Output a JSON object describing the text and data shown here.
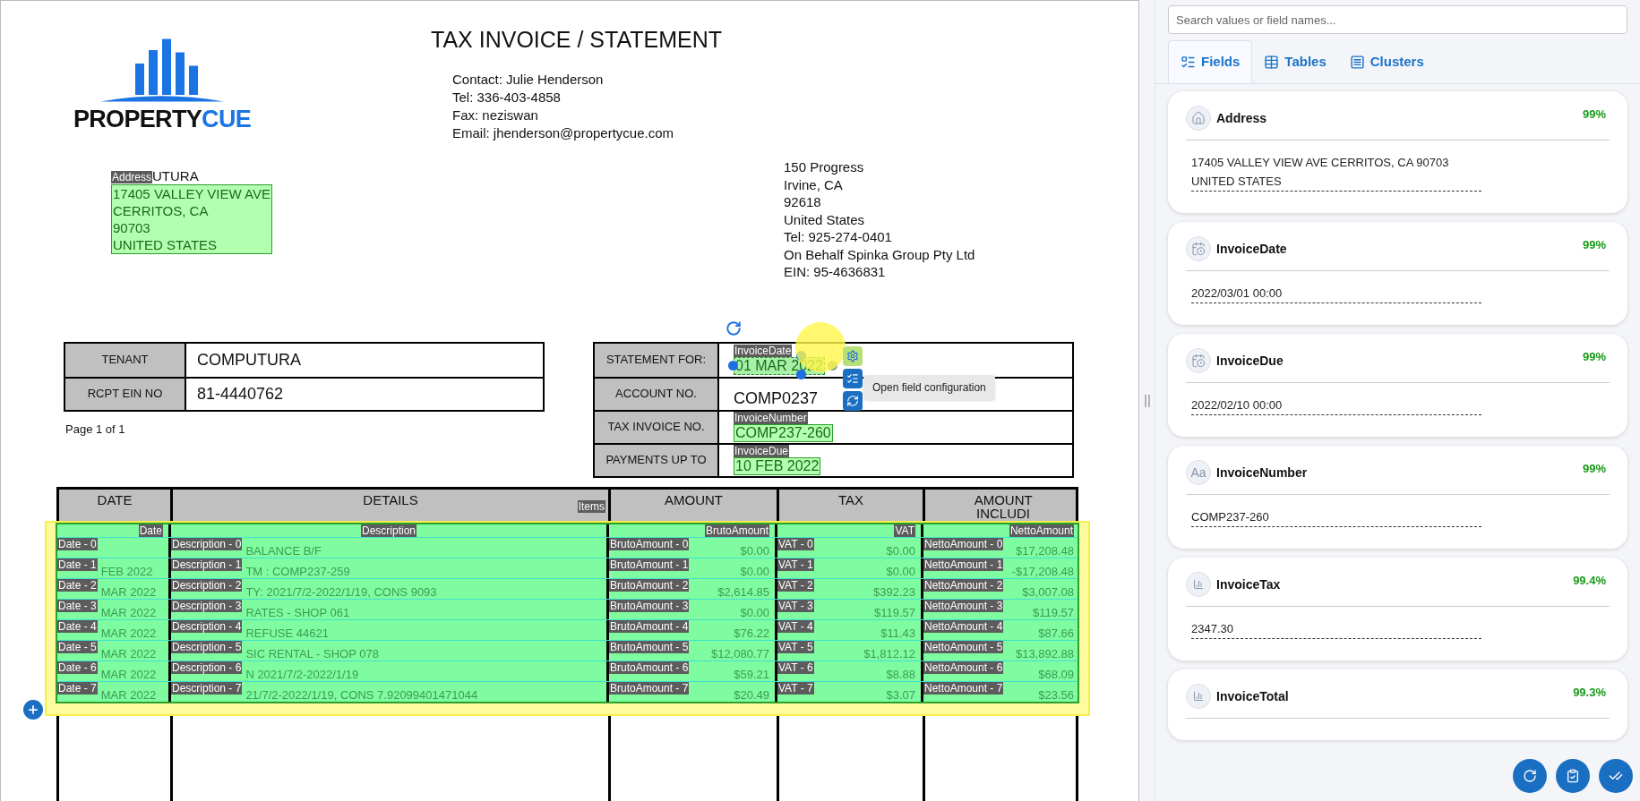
{
  "document": {
    "logo": {
      "word_dark": "PROPERTY",
      "word_accent": "CUE"
    },
    "title": "TAX INVOICE / STATEMENT",
    "contact_lines": [
      "Contact: Julie Henderson",
      "Tel: 336-403-4858",
      "Fax: neziswan",
      "Email: jhenderson@propertycue.com"
    ],
    "address_field": {
      "label": "Address",
      "above_text": "UTURA",
      "lines": [
        "17405 VALLEY VIEW AVE",
        "CERRITOS, CA",
        "90703",
        "UNITED STATES"
      ]
    },
    "sender_lines": [
      "150 Progress",
      "Irvine, CA",
      "92618",
      "United States",
      "Tel: 925-274-0401",
      "On Behalf Spinka Group Pty Ltd",
      "EIN: 95-4636831"
    ],
    "tenant_table": [
      {
        "label": "TENANT",
        "value": "COMPUTURA"
      },
      {
        "label": "RCPT EIN NO",
        "value": "81-4440762"
      }
    ],
    "page_note": "Page 1 of 1",
    "statement_table": [
      {
        "label": "STATEMENT FOR:",
        "field_label": "InvoiceDate",
        "value": "01 MAR 2022",
        "selected": true
      },
      {
        "label": "ACCOUNT NO.",
        "value": "COMP0237"
      },
      {
        "label": "TAX INVOICE NO.",
        "field_label": "InvoiceNumber",
        "value": "COMP237-260",
        "selected": false
      },
      {
        "label": "PAYMENTS UP TO",
        "field_label": "InvoiceDue",
        "value": "10 FEB 2022",
        "selected": false
      }
    ],
    "field_toolbar": {
      "tooltip": "Open field configuration"
    },
    "items_table": {
      "table_label": "Items",
      "columns": [
        {
          "heading": "DATE",
          "field_label": "Date",
          "kind": "text"
        },
        {
          "heading": "DETAILS",
          "field_label": "Description",
          "kind": "text"
        },
        {
          "heading": "AMOUNT",
          "field_label": "BrutoAmount",
          "kind": "amount"
        },
        {
          "heading": "TAX",
          "field_label": "VAT",
          "kind": "amount"
        },
        {
          "heading": "AMOUNT INCLUDI",
          "field_label": "NettoAmount",
          "kind": "amount"
        }
      ],
      "rows": [
        {
          "cells": [
            {
              "chip": "Date - 0"
            },
            {
              "chip": "Description - 0",
              "value": "BALANCE B/F"
            },
            {
              "chip": "BrutoAmount - 0",
              "value": "$0.00"
            },
            {
              "chip": "VAT - 0",
              "value": "$0.00"
            },
            {
              "chip": "NettoAmount - 0",
              "value": "$17,208.48"
            }
          ]
        },
        {
          "cells": [
            {
              "chip": "Date - 1",
              "value": "FEB 2022"
            },
            {
              "chip": "Description - 1",
              "value": "TM : COMP237-259"
            },
            {
              "chip": "BrutoAmount - 1",
              "value": "$0.00"
            },
            {
              "chip": "VAT - 1",
              "value": "$0.00"
            },
            {
              "chip": "NettoAmount - 1",
              "value": "-$17,208.48"
            }
          ]
        },
        {
          "cells": [
            {
              "chip": "Date - 2",
              "value": "MAR 2022"
            },
            {
              "chip": "Description - 2",
              "value": "TY: 2021/7/2-2022/1/19, CONS 9093"
            },
            {
              "chip": "BrutoAmount - 2",
              "value": "$2,614.85"
            },
            {
              "chip": "VAT - 2",
              "value": "$392.23"
            },
            {
              "chip": "NettoAmount - 2",
              "value": "$3,007.08"
            }
          ]
        },
        {
          "cells": [
            {
              "chip": "Date - 3",
              "value": "MAR 2022"
            },
            {
              "chip": "Description - 3",
              "value": "RATES - SHOP 061"
            },
            {
              "chip": "BrutoAmount - 3",
              "value": "$0.00"
            },
            {
              "chip": "VAT - 3",
              "value": "$119.57"
            },
            {
              "chip": "NettoAmount - 3",
              "value": "$119.57"
            }
          ]
        },
        {
          "cells": [
            {
              "chip": "Date - 4",
              "value": "MAR 2022"
            },
            {
              "chip": "Description - 4",
              "value": "REFUSE 44621"
            },
            {
              "chip": "BrutoAmount - 4",
              "value": "$76.22"
            },
            {
              "chip": "VAT - 4",
              "value": "$11.43"
            },
            {
              "chip": "NettoAmount - 4",
              "value": "$87.66"
            }
          ]
        },
        {
          "cells": [
            {
              "chip": "Date - 5",
              "value": "MAR 2022"
            },
            {
              "chip": "Description - 5",
              "value": "SIC RENTAL - SHOP 078"
            },
            {
              "chip": "BrutoAmount - 5",
              "value": "$12,080.77"
            },
            {
              "chip": "VAT - 5",
              "value": "$1,812.12"
            },
            {
              "chip": "NettoAmount - 5",
              "value": "$13,892.88"
            }
          ]
        },
        {
          "cells": [
            {
              "chip": "Date - 6",
              "value": "MAR 2022"
            },
            {
              "chip": "Description - 6",
              "value": "N 2021/7/2-2022/1/19"
            },
            {
              "chip": "BrutoAmount - 6",
              "value": "$59.21"
            },
            {
              "chip": "VAT - 6",
              "value": "$8.88"
            },
            {
              "chip": "NettoAmount - 6",
              "value": "$68.09"
            }
          ]
        },
        {
          "cells": [
            {
              "chip": "Date - 7",
              "value": "MAR 2022"
            },
            {
              "chip": "Description - 7",
              "value": "21/7/2-2022/1/19, CONS 7.92099401471044"
            },
            {
              "chip": "BrutoAmount - 7",
              "value": "$20.49"
            },
            {
              "chip": "VAT - 7",
              "value": "$3.07"
            },
            {
              "chip": "NettoAmount - 7",
              "value": "$23.56"
            }
          ]
        }
      ]
    }
  },
  "sidebar": {
    "search": {
      "placeholder": "Search values or field names..."
    },
    "tabs": [
      {
        "label": "Fields",
        "kind": "fields",
        "selected": true
      },
      {
        "label": "Tables",
        "kind": "tables",
        "selected": false
      },
      {
        "label": "Clusters",
        "kind": "clusters",
        "selected": false
      }
    ],
    "fields": [
      {
        "kind": "address",
        "name": "Address",
        "confidence": "99%",
        "value": "17405 VALLEY VIEW AVE CERRITOS, CA 90703 UNITED STATES"
      },
      {
        "kind": "date",
        "name": "InvoiceDate",
        "confidence": "99%",
        "value": "2022/03/01 00:00"
      },
      {
        "kind": "date",
        "name": "InvoiceDue",
        "confidence": "99%",
        "value": "2022/02/10 00:00"
      },
      {
        "kind": "text",
        "icon_text": "Aa",
        "name": "InvoiceNumber",
        "confidence": "99%",
        "value": "COMP237-260"
      },
      {
        "kind": "number",
        "name": "InvoiceTax",
        "confidence": "99.4%",
        "value": "2347.30"
      },
      {
        "kind": "number",
        "name": "InvoiceTotal",
        "confidence": "99.3%"
      }
    ]
  }
}
